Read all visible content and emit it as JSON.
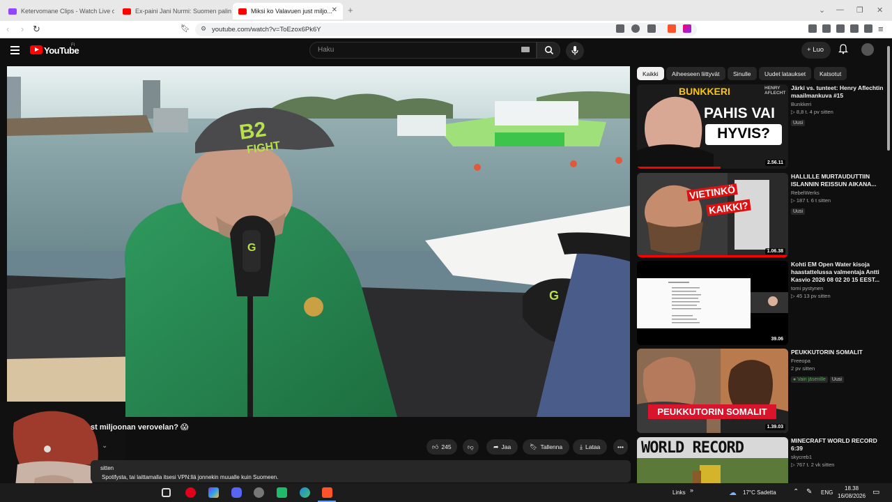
{
  "browser": {
    "tabs": [
      {
        "title": "Ketervomane Clips - Watch Live on K..."
      },
      {
        "title": "Ex-paini Jani Nurmi: Suomen palini..."
      },
      {
        "title": "Miksi ko Valavuen just miljo..."
      }
    ],
    "url": "youtube.com/watch?v=ToEzox6Pk6Y"
  },
  "header": {
    "logo": "YouTube",
    "logo_sup": "FI",
    "search_placeholder": "Haku",
    "create_label": "Luo"
  },
  "video": {
    "title": "st miljoonan verovelan? 😱",
    "likes": "245",
    "share_label": "Jaa",
    "save_label": "Tallenna",
    "download_label": "Lataa",
    "desc_line1": "sitten",
    "desc_line2": "Spotifysta, tai laittamalla itsesi VPN:llä jonnekin muualle kuin Suomeen."
  },
  "chips": [
    "Kaikki",
    "Aiheeseen liittyvät",
    "Sinulle",
    "Uudet lataukset",
    "Katsotut"
  ],
  "recommendations": [
    {
      "title": "Järki vs. tunteet: Henry Aflechtin maailmankuva #15",
      "channel": "Bunkkeri",
      "stats": "▷ 8,8 t.   4 pv sitten",
      "badges": [
        "Uusi"
      ],
      "duration": "2.56.11",
      "thumb_text": {
        "line1": "BUNKKERI",
        "line2": "PAHIS VAI",
        "line3": "HYVIS?",
        "tag": "HENRY AFLECHT"
      }
    },
    {
      "title": "HALLILLE MURTAUDUTTIIN ISLANNIN REISSUN AIKANA...",
      "channel": "RebelWerks",
      "stats": "▷ 187 t.   6 t sitten",
      "badges": [
        "Uusi"
      ],
      "duration": "1.06.38",
      "thumb_text": {
        "line1": "VIETINKÖ",
        "line2": "KAIKKI?"
      }
    },
    {
      "title": "Kohti EM Open Water kisoja haastattelussa valmentaja  Antti Kasvio  2026 08 02 20 15 EEST...",
      "channel": "tomi pystynen",
      "stats": "▷ 45   13 pv sitten",
      "badges": [],
      "duration": "39.06"
    },
    {
      "title": "PEUKKUTORIN SOMALIT",
      "channel": "Freeopa",
      "stats": "2 pv sitten",
      "badges": [
        "Vain jäsenille",
        "Uusi"
      ],
      "duration": "1.39.03",
      "thumb_text": {
        "line1": "PEUKKUTORIN SOMALIT"
      }
    },
    {
      "title": "MINECRAFT WORLD RECORD 6:39",
      "channel": "skycreb1",
      "stats": "▷ 767 t.   2 vk sitten",
      "badges": [],
      "duration": "",
      "thumb_text": {
        "line1": "WORLD RECORD"
      }
    }
  ],
  "taskbar": {
    "links_label": "Links",
    "weather": "17°C  Sadetta",
    "lang": "ENG",
    "time": "18.38",
    "date": "16/08/2026"
  },
  "colors": {
    "accent": "#ff0000",
    "bg": "#0f0f0f",
    "chip": "#272727",
    "green_badge": "#4caf50"
  }
}
